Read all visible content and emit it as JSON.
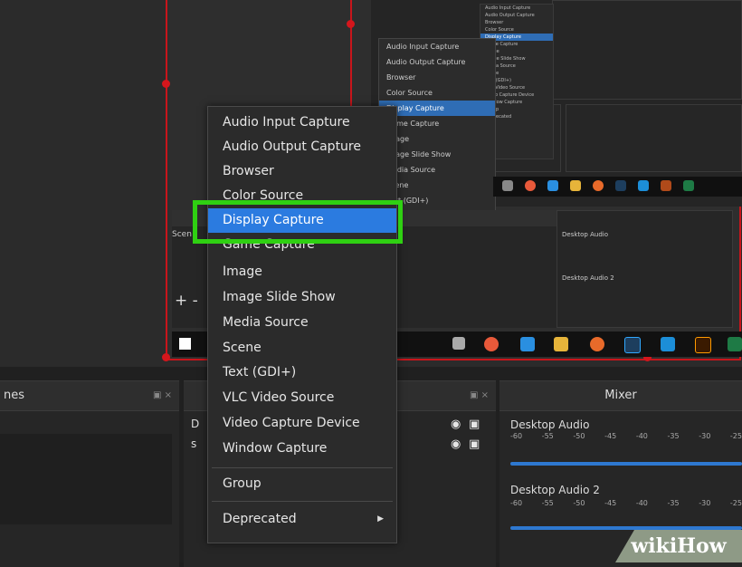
{
  "context_menu": {
    "items": [
      {
        "label": "Audio Input Capture"
      },
      {
        "label": "Audio Output Capture"
      },
      {
        "label": "Browser"
      },
      {
        "label": "Color Source"
      },
      {
        "label": "Display Capture"
      },
      {
        "label": "Game Capture"
      },
      {
        "label": "Image"
      },
      {
        "label": "Image Slide Show"
      },
      {
        "label": "Media Source"
      },
      {
        "label": "Scene"
      },
      {
        "label": "Text (GDI+)"
      },
      {
        "label": "VLC Video Source"
      },
      {
        "label": "Video Capture Device"
      },
      {
        "label": "Window Capture"
      }
    ],
    "group_label": "Group",
    "deprecated_label": "Deprecated",
    "selected_label": "Display Capture"
  },
  "small_menu": {
    "items": [
      "Audio Input Capture",
      "Audio Output Capture",
      "Browser",
      "Color Source",
      "Display Capture",
      "Game Capture",
      "Image",
      "Image Slide Show",
      "Media Source",
      "Scene",
      "Text (GDI+)",
      "VLC Video Source",
      "Video Capture Device",
      "Window Capture",
      "Group",
      "Deprecated"
    ]
  },
  "docks": {
    "scenes_title": "nes",
    "sources_title": "",
    "mixer_title": "Mixer",
    "source_row_1": "D",
    "source_row_2": "s",
    "mixer_tracks": [
      {
        "name": "Desktop Audio"
      },
      {
        "name": "Desktop Audio 2"
      }
    ],
    "ticks": [
      "-60",
      "-55",
      "-50",
      "-45",
      "-40",
      "-35",
      "-30",
      "-25"
    ],
    "dock_controls": "▣ ×"
  },
  "preview": {
    "scene_label": "Scen",
    "plus_minus": "+ -"
  },
  "watermark": {
    "text": "wikiHow"
  },
  "colors": {
    "accent": "#2b7be0",
    "highlight": "#2fd012",
    "frame_red": "#c8151b"
  }
}
